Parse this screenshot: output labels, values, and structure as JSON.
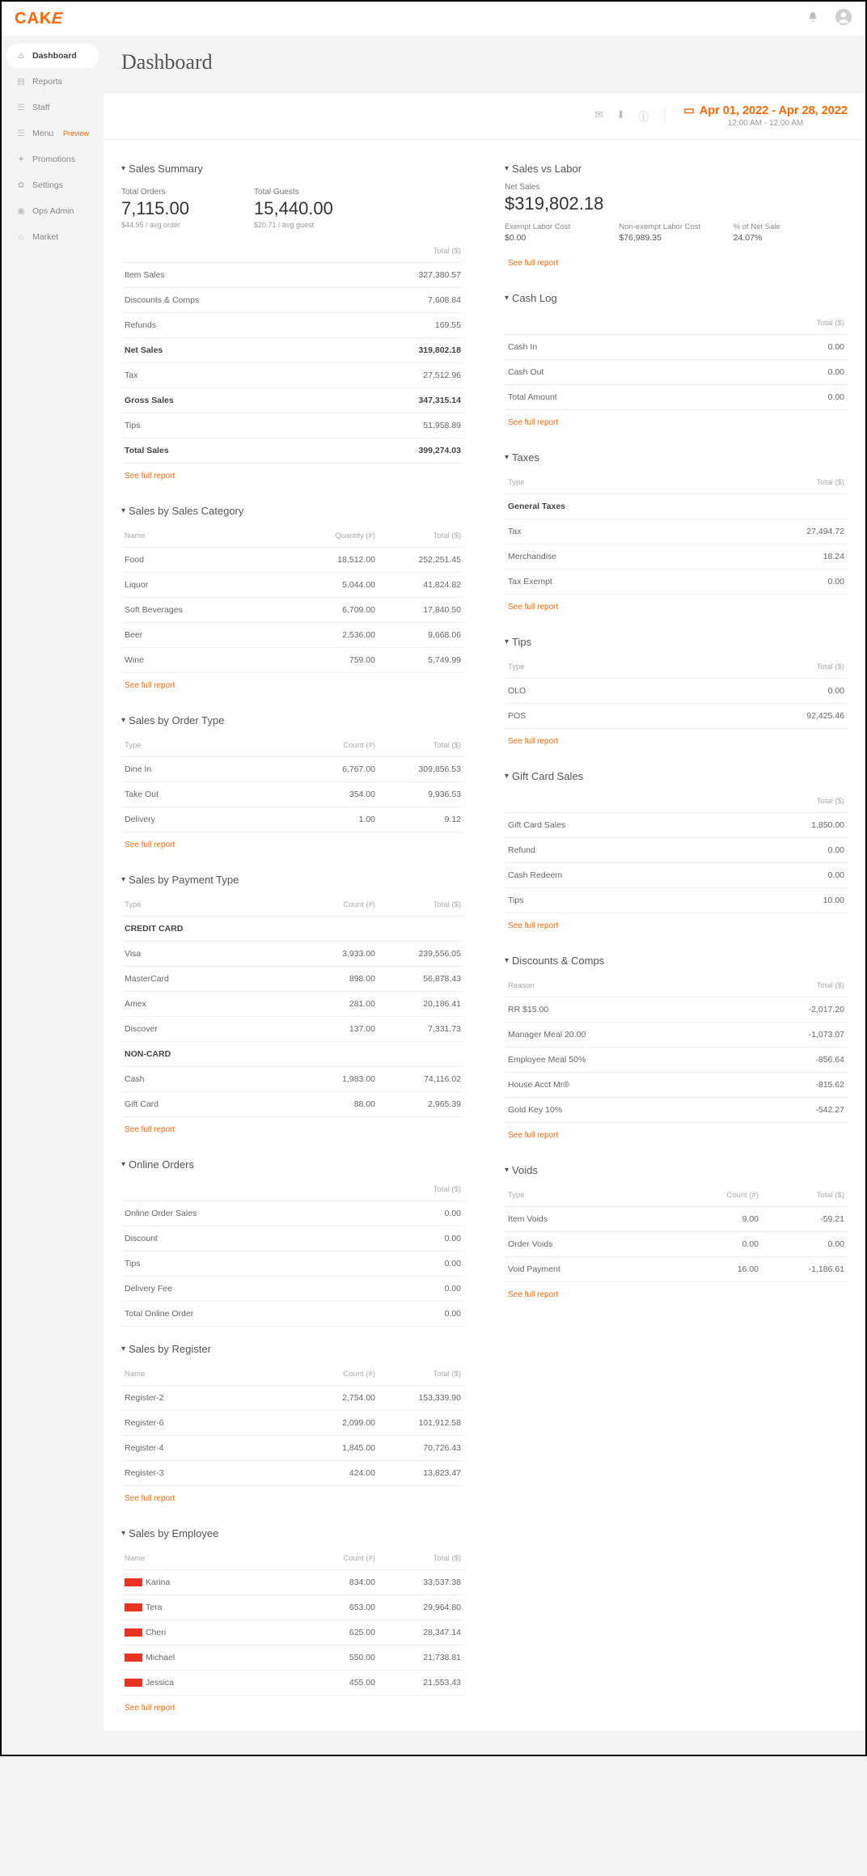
{
  "logo": "CAKE",
  "nav": {
    "items": [
      {
        "label": "Dashboard",
        "active": true
      },
      {
        "label": "Reports"
      },
      {
        "label": "Staff"
      },
      {
        "label": "Menu",
        "badge": "Preview"
      },
      {
        "label": "Promotions"
      },
      {
        "label": "Settings"
      },
      {
        "label": "Ops Admin"
      },
      {
        "label": "Market"
      }
    ]
  },
  "page_title": "Dashboard",
  "date": {
    "range": "Apr 01, 2022 - Apr 28, 2022",
    "sub": "12:00 AM - 12:00 AM"
  },
  "sales_summary": {
    "title": "Sales Summary",
    "k1_label": "Total Orders",
    "k1_val": "7,115.00",
    "k1_sub": "$44.95 / avg order",
    "k2_label": "Total Guests",
    "k2_val": "15,440.00",
    "k2_sub": "$20.71 / avg guest",
    "col_total": "Total ($)",
    "rows": [
      {
        "l": "Item Sales",
        "v": "327,380.57"
      },
      {
        "l": "Discounts & Comps",
        "v": "7,608.84"
      },
      {
        "l": "Refunds",
        "v": "169.55"
      },
      {
        "l": "Net Sales",
        "v": "319,802.18",
        "bold": true
      },
      {
        "l": "Tax",
        "v": "27,512.96"
      },
      {
        "l": "Gross Sales",
        "v": "347,315.14",
        "bold": true
      },
      {
        "l": "Tips",
        "v": "51,958.89"
      },
      {
        "l": "Total Sales",
        "v": "399,274.03",
        "bold": true
      }
    ]
  },
  "by_category": {
    "title": "Sales by Sales Category",
    "h1": "Name",
    "h2": "Quantity (#)",
    "h3": "Total ($)",
    "rows": [
      {
        "n": "Food",
        "q": "18,512.00",
        "t": "252,251.45"
      },
      {
        "n": "Liquor",
        "q": "5,044.00",
        "t": "41,824.82"
      },
      {
        "n": "Soft Beverages",
        "q": "6,709.00",
        "t": "17,840.50"
      },
      {
        "n": "Beer",
        "q": "2,536.00",
        "t": "9,668.06"
      },
      {
        "n": "Wine",
        "q": "759.00",
        "t": "5,749.99"
      }
    ]
  },
  "by_order": {
    "title": "Sales by Order Type",
    "h1": "Type",
    "h2": "Count (#)",
    "h3": "Total ($)",
    "rows": [
      {
        "n": "Dine In",
        "q": "6,767.00",
        "t": "309,856.53"
      },
      {
        "n": "Take Out",
        "q": "354.00",
        "t": "9,936.53"
      },
      {
        "n": "Delivery",
        "q": "1.00",
        "t": "9.12"
      }
    ]
  },
  "by_payment": {
    "title": "Sales by Payment Type",
    "h1": "Type",
    "h2": "Count (#)",
    "h3": "Total ($)",
    "sec1": "CREDIT CARD",
    "s1": [
      {
        "n": "Visa",
        "q": "3,933.00",
        "t": "239,556.05"
      },
      {
        "n": "MasterCard",
        "q": "898.00",
        "t": "56,878.43"
      },
      {
        "n": "Amex",
        "q": "281.00",
        "t": "20,186.41"
      },
      {
        "n": "Discover",
        "q": "137.00",
        "t": "7,331.73"
      }
    ],
    "sec2": "NON-CARD",
    "s2": [
      {
        "n": "Cash",
        "q": "1,983.00",
        "t": "74,116.02"
      },
      {
        "n": "Gift Card",
        "q": "88.00",
        "t": "2,965.39"
      }
    ]
  },
  "online": {
    "title": "Online Orders",
    "h": "Total ($)",
    "rows": [
      {
        "n": "Online Order Sales",
        "v": "0.00"
      },
      {
        "n": "Discount",
        "v": "0.00"
      },
      {
        "n": "Tips",
        "v": "0.00"
      },
      {
        "n": "Delivery Fee",
        "v": "0.00"
      },
      {
        "n": "Total Online Order",
        "v": "0.00"
      }
    ]
  },
  "by_register": {
    "title": "Sales by Register",
    "h1": "Name",
    "h2": "Count (#)",
    "h3": "Total ($)",
    "rows": [
      {
        "n": "Register-2",
        "q": "2,754.00",
        "t": "153,339.90"
      },
      {
        "n": "Register-6",
        "q": "2,099.00",
        "t": "101,912.58"
      },
      {
        "n": "Register-4",
        "q": "1,845.00",
        "t": "70,726.43"
      },
      {
        "n": "Register-3",
        "q": "424.00",
        "t": "13,823.47"
      }
    ]
  },
  "by_employee": {
    "title": "Sales by Employee",
    "h1": "Name",
    "h2": "Count (#)",
    "h3": "Total ($)",
    "rows": [
      {
        "n": "Karina",
        "q": "834.00",
        "t": "33,537.38"
      },
      {
        "n": "Tera",
        "q": "653.00",
        "t": "29,964.80"
      },
      {
        "n": "Cheri",
        "q": "625.00",
        "t": "28,347.14"
      },
      {
        "n": "Michael",
        "q": "550.00",
        "t": "21,738.81"
      },
      {
        "n": "Jessica",
        "q": "455.00",
        "t": "21,553.43"
      }
    ]
  },
  "sales_labor": {
    "title": "Sales vs Labor",
    "k_label": "Net Sales",
    "k_val": "$319,802.18",
    "s1_l": "Exempt Labor Cost",
    "s1_v": "$0.00",
    "s2_l": "Non-exempt Labor Cost",
    "s2_v": "$76,989.35",
    "s3_l": "% of Net Sale",
    "s3_v": "24.07%"
  },
  "cash_log": {
    "title": "Cash Log",
    "h": "Total ($)",
    "rows": [
      {
        "n": "Cash In",
        "v": "0.00"
      },
      {
        "n": "Cash Out",
        "v": "0.00"
      },
      {
        "n": "Total Amount",
        "v": "0.00"
      }
    ]
  },
  "taxes": {
    "title": "Taxes",
    "h1": "Type",
    "h2": "Total ($)",
    "sec": "General Taxes",
    "rows": [
      {
        "n": "Tax",
        "v": "27,494.72"
      },
      {
        "n": "Merchandise",
        "v": "18.24"
      },
      {
        "n": "Tax Exempt",
        "v": "0.00"
      }
    ]
  },
  "tips": {
    "title": "Tips",
    "h1": "Type",
    "h2": "Total ($)",
    "rows": [
      {
        "n": "OLO",
        "v": "0.00"
      },
      {
        "n": "POS",
        "v": "92,425.46"
      }
    ]
  },
  "gift": {
    "title": "Gift Card Sales",
    "h": "Total ($)",
    "rows": [
      {
        "n": "Gift Card Sales",
        "v": "1,850.00"
      },
      {
        "n": "Refund",
        "v": "0.00"
      },
      {
        "n": "Cash Redeem",
        "v": "0.00"
      },
      {
        "n": "Tips",
        "v": "10.00"
      }
    ]
  },
  "discounts": {
    "title": "Discounts & Comps",
    "h1": "Reason",
    "h2": "Total ($)",
    "rows": [
      {
        "n": "RR $15.00",
        "v": "-2,017.20"
      },
      {
        "n": "Manager Meal 20.00",
        "v": "-1,073.07"
      },
      {
        "n": "Employee Meal 50%",
        "v": "-856.64"
      },
      {
        "n": "House Acct Mr®",
        "v": "-815.62"
      },
      {
        "n": "Gold Key 10%",
        "v": "-542.27"
      }
    ]
  },
  "voids": {
    "title": "Voids",
    "h1": "Type",
    "h2": "Count (#)",
    "h3": "Total ($)",
    "rows": [
      {
        "n": "Item Voids",
        "q": "9.00",
        "t": "-59.21"
      },
      {
        "n": "Order Voids",
        "q": "0.00",
        "t": "0.00"
      },
      {
        "n": "Void Payment",
        "q": "16.00",
        "t": "-1,186.61"
      }
    ]
  },
  "see_full": "See full report"
}
